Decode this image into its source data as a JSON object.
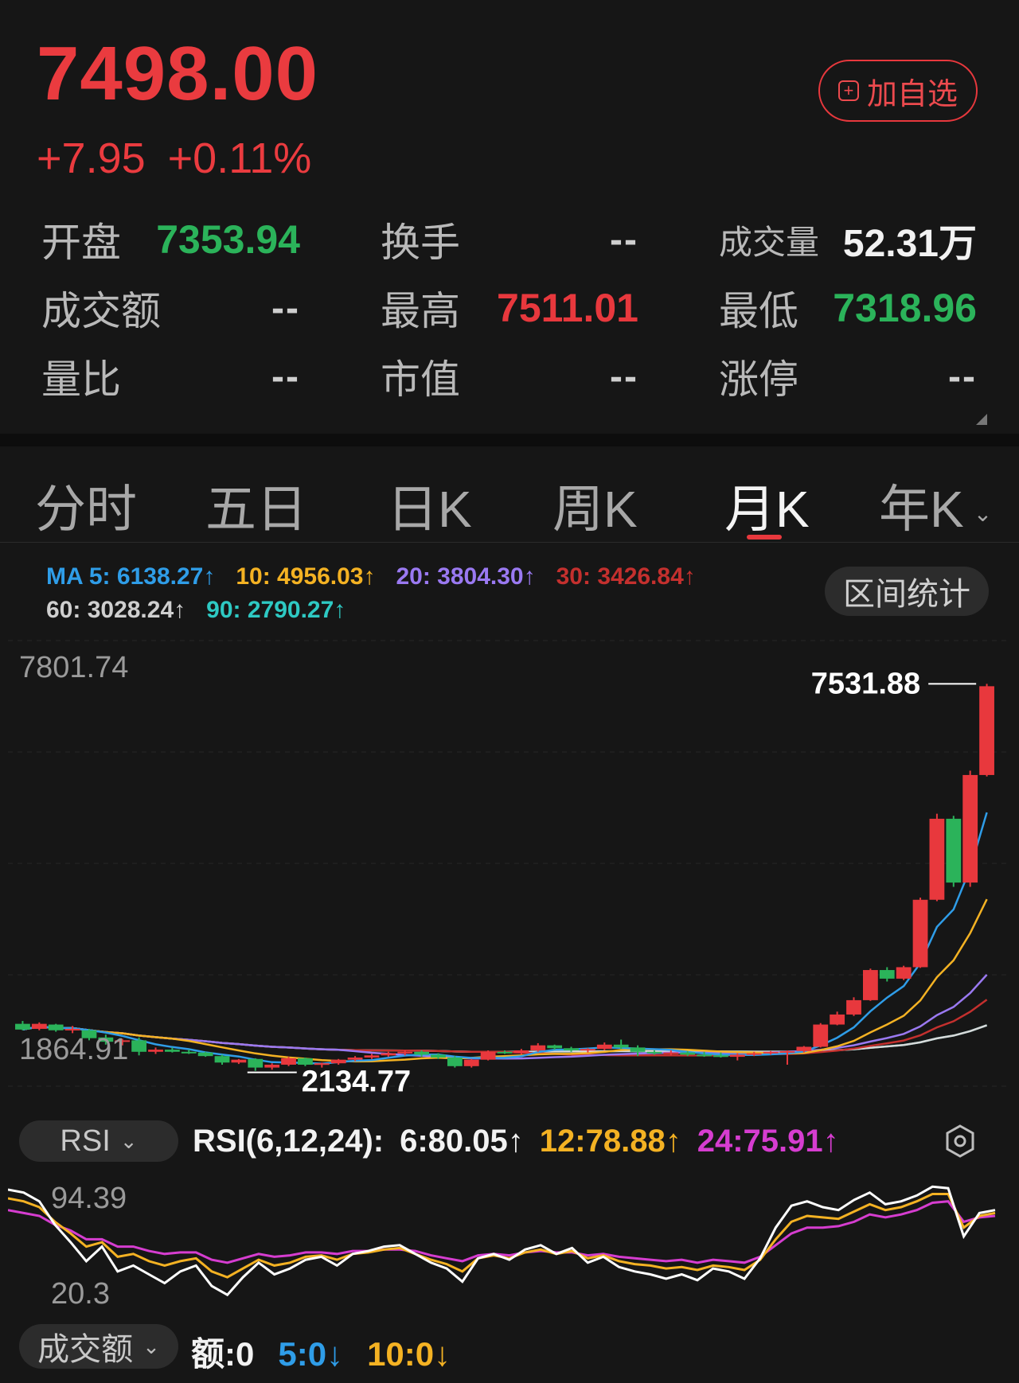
{
  "header": {
    "price": "7498.00",
    "change": "+7.95",
    "change_pct": "+0.11%",
    "add_watchlist": "加自选"
  },
  "stats": {
    "open_label": "开盘",
    "open_value": "7353.94",
    "turnover_rate_label": "换手",
    "turnover_rate_value": "--",
    "volume_label": "成交量",
    "volume_value": "52.31万",
    "amount_label": "成交额",
    "amount_value": "--",
    "high_label": "最高",
    "high_value": "7511.01",
    "low_label": "最低",
    "low_value": "7318.96",
    "volume_ratio_label": "量比",
    "volume_ratio_value": "--",
    "market_cap_label": "市值",
    "market_cap_value": "--",
    "limit_up_label": "涨停",
    "limit_up_value": "--"
  },
  "tabs": [
    "分时",
    "五日",
    "日K",
    "周K",
    "月K",
    "年K"
  ],
  "active_tab": "月K",
  "ma": {
    "ma5": "MA 5: 6138.27↑",
    "ma10": "10: 4956.03↑",
    "ma20": "20: 3804.30↑",
    "ma30": "30: 3426.84↑",
    "ma60": "60: 3028.24↑",
    "ma90": "90: 2790.27↑"
  },
  "interval_button": "区间统计",
  "chart_data": {
    "type": "candlestick",
    "period": "月K",
    "y_axis_top": "7801.74",
    "y_axis_bottom": "1864.91",
    "ylim": [
      1864.91,
      7801.74
    ],
    "max_label": "7531.88",
    "min_label": "2134.77",
    "grid": true,
    "candles": [
      {
        "o": 2790,
        "h": 2830,
        "l": 2700,
        "c": 2710
      },
      {
        "o": 2720,
        "h": 2810,
        "l": 2700,
        "c": 2790
      },
      {
        "o": 2780,
        "h": 2790,
        "l": 2680,
        "c": 2700
      },
      {
        "o": 2700,
        "h": 2760,
        "l": 2660,
        "c": 2720
      },
      {
        "o": 2700,
        "h": 2720,
        "l": 2560,
        "c": 2590
      },
      {
        "o": 2600,
        "h": 2640,
        "l": 2500,
        "c": 2540
      },
      {
        "o": 2540,
        "h": 2580,
        "l": 2490,
        "c": 2560
      },
      {
        "o": 2560,
        "h": 2600,
        "l": 2350,
        "c": 2400
      },
      {
        "o": 2400,
        "h": 2460,
        "l": 2370,
        "c": 2430
      },
      {
        "o": 2430,
        "h": 2460,
        "l": 2390,
        "c": 2400
      },
      {
        "o": 2400,
        "h": 2430,
        "l": 2370,
        "c": 2390
      },
      {
        "o": 2390,
        "h": 2400,
        "l": 2330,
        "c": 2340
      },
      {
        "o": 2340,
        "h": 2360,
        "l": 2220,
        "c": 2250
      },
      {
        "o": 2250,
        "h": 2300,
        "l": 2230,
        "c": 2290
      },
      {
        "o": 2300,
        "h": 2310,
        "l": 2134.77,
        "c": 2180
      },
      {
        "o": 2180,
        "h": 2240,
        "l": 2150,
        "c": 2220
      },
      {
        "o": 2220,
        "h": 2330,
        "l": 2200,
        "c": 2310
      },
      {
        "o": 2310,
        "h": 2320,
        "l": 2200,
        "c": 2220
      },
      {
        "o": 2220,
        "h": 2250,
        "l": 2180,
        "c": 2240
      },
      {
        "o": 2240,
        "h": 2300,
        "l": 2220,
        "c": 2290
      },
      {
        "o": 2290,
        "h": 2340,
        "l": 2270,
        "c": 2320
      },
      {
        "o": 2320,
        "h": 2370,
        "l": 2300,
        "c": 2350
      },
      {
        "o": 2350,
        "h": 2400,
        "l": 2330,
        "c": 2380
      },
      {
        "o": 2380,
        "h": 2420,
        "l": 2350,
        "c": 2400
      },
      {
        "o": 2400,
        "h": 2420,
        "l": 2330,
        "c": 2360
      },
      {
        "o": 2360,
        "h": 2380,
        "l": 2300,
        "c": 2320
      },
      {
        "o": 2320,
        "h": 2340,
        "l": 2180,
        "c": 2200
      },
      {
        "o": 2200,
        "h": 2300,
        "l": 2180,
        "c": 2290
      },
      {
        "o": 2290,
        "h": 2420,
        "l": 2280,
        "c": 2400
      },
      {
        "o": 2400,
        "h": 2420,
        "l": 2370,
        "c": 2380
      },
      {
        "o": 2380,
        "h": 2440,
        "l": 2360,
        "c": 2420
      },
      {
        "o": 2420,
        "h": 2520,
        "l": 2400,
        "c": 2490
      },
      {
        "o": 2490,
        "h": 2500,
        "l": 2430,
        "c": 2450
      },
      {
        "o": 2450,
        "h": 2470,
        "l": 2400,
        "c": 2420
      },
      {
        "o": 2420,
        "h": 2450,
        "l": 2390,
        "c": 2440
      },
      {
        "o": 2440,
        "h": 2530,
        "l": 2420,
        "c": 2500
      },
      {
        "o": 2500,
        "h": 2570,
        "l": 2440,
        "c": 2460
      },
      {
        "o": 2460,
        "h": 2490,
        "l": 2340,
        "c": 2400
      },
      {
        "o": 2400,
        "h": 2420,
        "l": 2360,
        "c": 2380
      },
      {
        "o": 2380,
        "h": 2420,
        "l": 2350,
        "c": 2390
      },
      {
        "o": 2390,
        "h": 2410,
        "l": 2340,
        "c": 2360
      },
      {
        "o": 2360,
        "h": 2400,
        "l": 2330,
        "c": 2350
      },
      {
        "o": 2350,
        "h": 2390,
        "l": 2320,
        "c": 2330
      },
      {
        "o": 2330,
        "h": 2380,
        "l": 2280,
        "c": 2360
      },
      {
        "o": 2360,
        "h": 2400,
        "l": 2340,
        "c": 2380
      },
      {
        "o": 2380,
        "h": 2410,
        "l": 2360,
        "c": 2400
      },
      {
        "o": 2400,
        "h": 2420,
        "l": 2220,
        "c": 2410
      },
      {
        "o": 2410,
        "h": 2480,
        "l": 2390,
        "c": 2470
      },
      {
        "o": 2470,
        "h": 2800,
        "l": 2460,
        "c": 2780
      },
      {
        "o": 2780,
        "h": 2960,
        "l": 2770,
        "c": 2920
      },
      {
        "o": 2920,
        "h": 3160,
        "l": 2900,
        "c": 3120
      },
      {
        "o": 3120,
        "h": 3560,
        "l": 3110,
        "c": 3540
      },
      {
        "o": 3540,
        "h": 3580,
        "l": 3380,
        "c": 3420
      },
      {
        "o": 3420,
        "h": 3600,
        "l": 3400,
        "c": 3580
      },
      {
        "o": 3580,
        "h": 4550,
        "l": 3570,
        "c": 4520
      },
      {
        "o": 4520,
        "h": 5720,
        "l": 4500,
        "c": 5650
      },
      {
        "o": 5650,
        "h": 5690,
        "l": 4700,
        "c": 4760
      },
      {
        "o": 4760,
        "h": 6320,
        "l": 4700,
        "c": 6260
      },
      {
        "o": 6260,
        "h": 7531.88,
        "l": 6240,
        "c": 7498.0
      }
    ]
  },
  "rsi": {
    "selector": "RSI",
    "title": "RSI(6,12,24):",
    "rsi6": "6:80.05↑",
    "rsi12": "12:78.88↑",
    "rsi24": "24:75.91↑",
    "y_top": "94.39",
    "y_bottom": "20.3",
    "rsi6_values": [
      94,
      92,
      86,
      70,
      58,
      45,
      55,
      38,
      42,
      36,
      30,
      38,
      42,
      28,
      22,
      34,
      44,
      36,
      40,
      46,
      48,
      42,
      50,
      52,
      55,
      56,
      50,
      44,
      40,
      31,
      47,
      50,
      46,
      53,
      56,
      50,
      54,
      44,
      48,
      41,
      38,
      36,
      33,
      36,
      32,
      40,
      38,
      33,
      47,
      68,
      83,
      86,
      82,
      80,
      87,
      92,
      84,
      86,
      90,
      96,
      95,
      62,
      78,
      80
    ],
    "rsi12_values": [
      88,
      86,
      82,
      72,
      64,
      55,
      58,
      48,
      50,
      45,
      42,
      45,
      47,
      38,
      34,
      40,
      46,
      42,
      44,
      48,
      49,
      46,
      50,
      51,
      53,
      54,
      50,
      46,
      43,
      38,
      47,
      49,
      47,
      51,
      53,
      50,
      52,
      47,
      49,
      45,
      43,
      42,
      40,
      41,
      39,
      42,
      41,
      39,
      46,
      60,
      72,
      76,
      75,
      74,
      79,
      84,
      80,
      82,
      86,
      91,
      91,
      68,
      76,
      78
    ],
    "rsi24_values": [
      80,
      78,
      76,
      70,
      66,
      60,
      60,
      55,
      55,
      52,
      50,
      51,
      51,
      46,
      44,
      47,
      50,
      48,
      49,
      51,
      51,
      50,
      52,
      52,
      53,
      53,
      52,
      49,
      47,
      45,
      49,
      50,
      49,
      51,
      52,
      51,
      51,
      49,
      50,
      48,
      47,
      46,
      45,
      46,
      44,
      46,
      45,
      44,
      48,
      56,
      64,
      68,
      68,
      69,
      72,
      77,
      75,
      77,
      80,
      85,
      86,
      72,
      75,
      76
    ]
  },
  "volume": {
    "selector": "成交额",
    "label": "额:0",
    "ma5": "5:0↓",
    "ma10": "10:0↓"
  },
  "colors": {
    "up": "#e8383d",
    "down": "#2bb35a",
    "ma5": "#2f9de8",
    "ma10": "#f4b223",
    "ma20": "#9a79f1",
    "ma30": "#c4302e",
    "ma60": "#d9d9d9",
    "ma90": "#2ec9c3",
    "rsi6": "#ffffff",
    "rsi12": "#f4b223",
    "rsi24": "#d63dd0"
  }
}
